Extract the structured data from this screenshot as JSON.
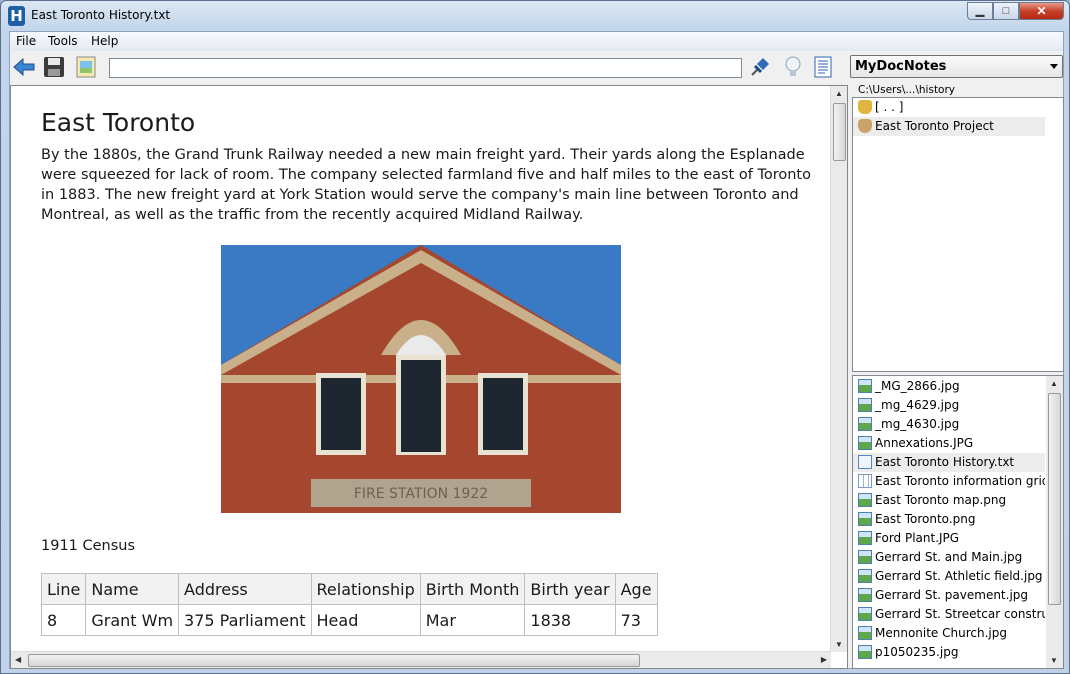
{
  "window": {
    "title": "East Toronto History.txt",
    "app_icon": "H"
  },
  "menu": {
    "file": "File",
    "tools": "Tools",
    "help": "Help"
  },
  "toolbar": {
    "address_value": "",
    "notes_dropdown": "MyDocNotes",
    "icons": [
      "back-arrow-icon",
      "save-icon",
      "image-icon",
      "pin-icon",
      "lightbulb-icon",
      "notes-icon"
    ]
  },
  "document": {
    "title": "East Toronto",
    "paragraph": "By the 1880s, the Grand Trunk Railway needed a new main freight yard. Their yards along the Esplanade were squeezed for lack of room. The company selected farmland five and half miles to the east of Toronto in 1883. The new freight yard at York Station would serve the company's main line between Toronto and Montreal, as well as the traffic from the recently acquired Midland Railway.",
    "photo_inscription": "FIRE STATION 1922",
    "caption": "1911 Census",
    "table": {
      "headers": [
        "Line",
        "Name",
        "Address",
        "Relationship",
        "Birth Month",
        "Birth year",
        "Age"
      ],
      "rows": [
        [
          "8",
          "Grant Wm",
          "375 Parliament",
          "Head",
          "Mar",
          "1838",
          "73"
        ]
      ]
    }
  },
  "sidebar": {
    "path": "C:\\Users\\...\\history",
    "folders": [
      {
        "label": "[ . . ]",
        "icon": "parent-folder-icon"
      },
      {
        "label": "East Toronto Project",
        "icon": "folder-icon"
      }
    ],
    "files": [
      {
        "label": "_MG_2866.jpg",
        "type": "img"
      },
      {
        "label": "_mg_4629.jpg",
        "type": "img"
      },
      {
        "label": "_mg_4630.jpg",
        "type": "img"
      },
      {
        "label": "Annexations.JPG",
        "type": "img"
      },
      {
        "label": "East Toronto History.txt",
        "type": "doc"
      },
      {
        "label": "East Toronto information grid....",
        "type": "grid"
      },
      {
        "label": "East Toronto map.png",
        "type": "img"
      },
      {
        "label": "East Toronto.png",
        "type": "img"
      },
      {
        "label": "Ford Plant.JPG",
        "type": "img"
      },
      {
        "label": "Gerrard St. and Main.jpg",
        "type": "img"
      },
      {
        "label": "Gerrard St. Athletic field.jpg",
        "type": "img"
      },
      {
        "label": "Gerrard St. pavement.jpg",
        "type": "img"
      },
      {
        "label": "Gerrard St. Streetcar constructi...",
        "type": "img"
      },
      {
        "label": "Mennonite Church.jpg",
        "type": "img"
      },
      {
        "label": "p1050235.jpg",
        "type": "img"
      }
    ],
    "selected_file": "East Toronto History.txt"
  }
}
